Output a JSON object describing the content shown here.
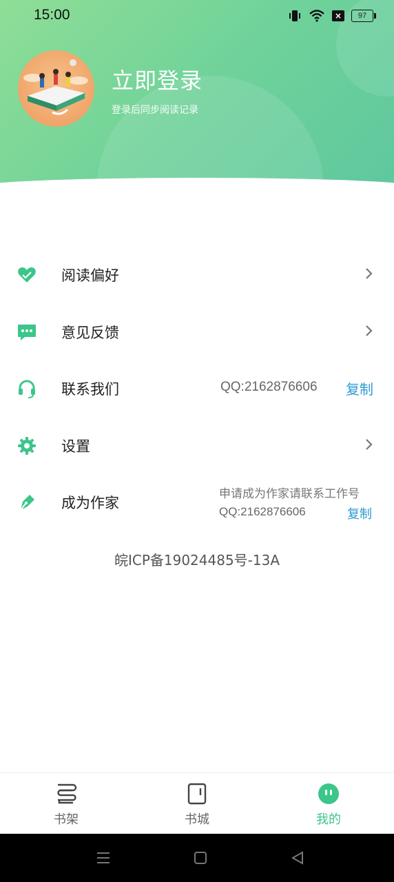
{
  "status_bar": {
    "time": "15:00",
    "battery": "97",
    "icons": [
      "vibrate-icon",
      "wifi-icon",
      "no-sim-icon",
      "battery-icon"
    ]
  },
  "profile": {
    "title": "立即登录",
    "subtitle": "登录后同步阅读记录"
  },
  "menu": [
    {
      "label": "阅读偏好",
      "icon": "heart-icon"
    },
    {
      "label": "意见反馈",
      "icon": "chat-bubble-icon"
    },
    {
      "label": "联系我们",
      "icon": "headset-icon",
      "qq": "QQ:2162876606",
      "copy": "复制"
    },
    {
      "label": "设置",
      "icon": "gear-icon"
    },
    {
      "label": "成为作家",
      "icon": "pen-icon",
      "note": "申请成为作家请联系工作号",
      "qq": "QQ:2162876606",
      "copy": "复制"
    }
  ],
  "icp": "皖ICP备19024485号-13A",
  "tabs": [
    {
      "label": "书架",
      "icon": "bookshelf-icon"
    },
    {
      "label": "书城",
      "icon": "bookstore-icon"
    },
    {
      "label": "我的",
      "icon": "profile-face-icon",
      "active": true
    }
  ],
  "colors": {
    "accent": "#3cc68a",
    "link": "#2d9ad3",
    "header_start": "#8fde96",
    "header_end": "#5ec79f"
  }
}
